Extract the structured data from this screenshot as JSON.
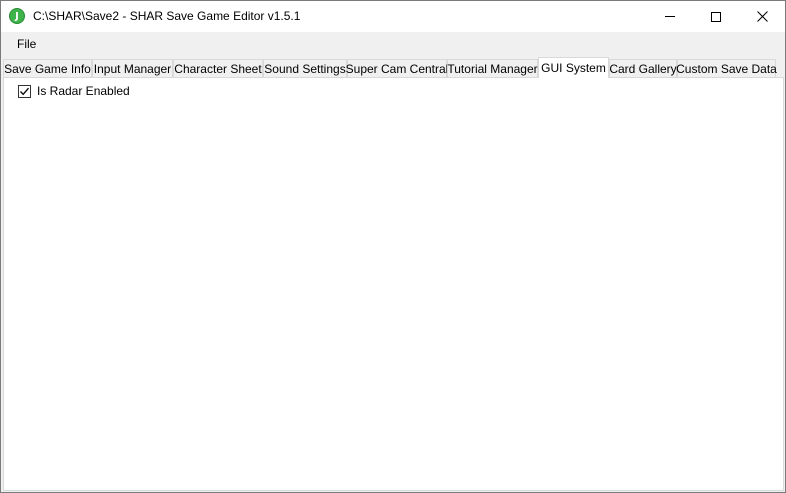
{
  "window": {
    "title": "C:\\SHAR\\Save2 - SHAR Save Game Editor v1.5.1",
    "app_icon_glyph": "J"
  },
  "menu": {
    "items": [
      {
        "label": "File"
      }
    ]
  },
  "tabs": [
    {
      "label": "Save Game Info",
      "active": false
    },
    {
      "label": "Input Manager",
      "active": false
    },
    {
      "label": "Character Sheet",
      "active": false
    },
    {
      "label": "Sound Settings",
      "active": false
    },
    {
      "label": "Super Cam Central",
      "active": false
    },
    {
      "label": "Tutorial Manager",
      "active": false
    },
    {
      "label": "GUI System",
      "active": true
    },
    {
      "label": "Card Gallery",
      "active": false
    },
    {
      "label": "Custom Save Data",
      "active": false
    }
  ],
  "gui_system": {
    "radar_checkbox": {
      "label": "Is Radar Enabled",
      "checked": true
    }
  },
  "colors": {
    "app_icon": "#3db34a",
    "tab_border": "#d9d9d9",
    "window_bg": "#f0f0f0"
  }
}
